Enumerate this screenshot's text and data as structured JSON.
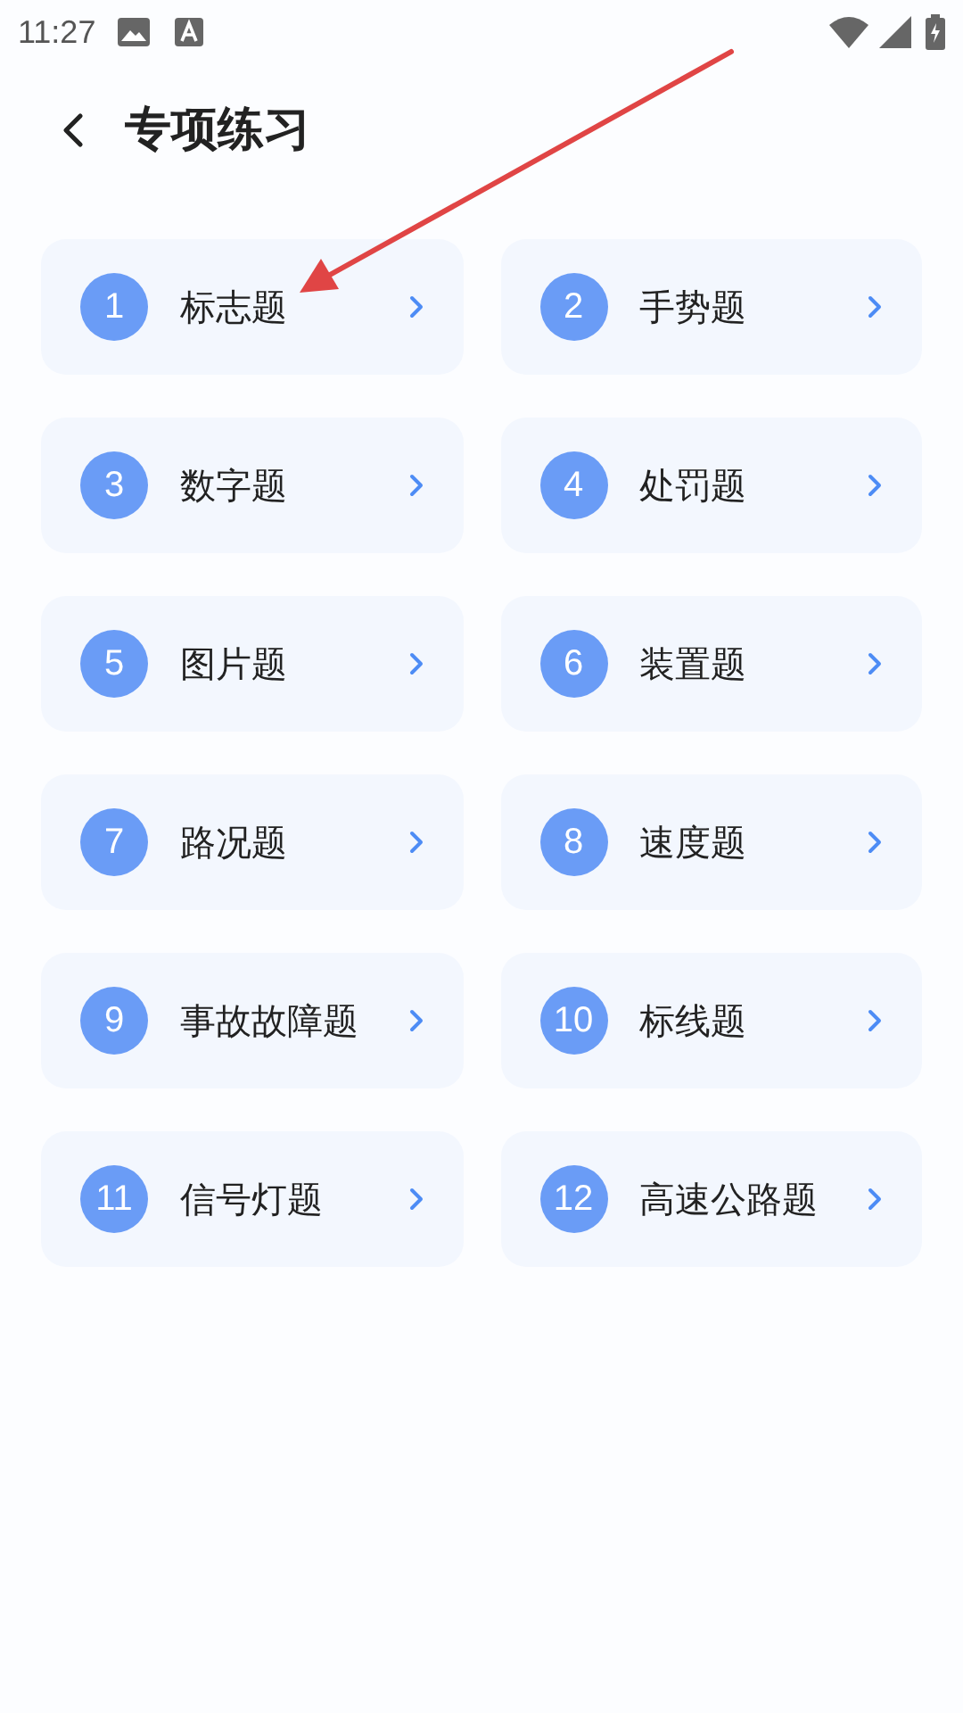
{
  "status_bar": {
    "time": "11:27"
  },
  "header": {
    "title": "专项练习"
  },
  "items": [
    {
      "number": "1",
      "label": "标志题"
    },
    {
      "number": "2",
      "label": "手势题"
    },
    {
      "number": "3",
      "label": "数字题"
    },
    {
      "number": "4",
      "label": "处罚题"
    },
    {
      "number": "5",
      "label": "图片题"
    },
    {
      "number": "6",
      "label": "装置题"
    },
    {
      "number": "7",
      "label": "路况题"
    },
    {
      "number": "8",
      "label": "速度题"
    },
    {
      "number": "9",
      "label": "事故故障题"
    },
    {
      "number": "10",
      "label": "标线题"
    },
    {
      "number": "11",
      "label": "信号灯题"
    },
    {
      "number": "12",
      "label": "高速公路题"
    }
  ]
}
